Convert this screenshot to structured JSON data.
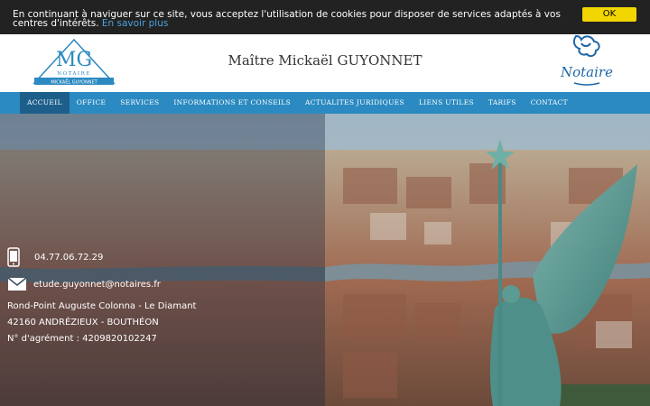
{
  "cookie": {
    "message": "En continuant à naviguer sur ce site, vous acceptez l'utilisation de cookies pour disposer de services adaptés à vos centres d'intérêts.",
    "link": "En savoir plus",
    "ok": "OK"
  },
  "header": {
    "logo_initials": "MG",
    "logo_notaire": "NOTAIRE",
    "logo_name": "MICKAËL GUYONNET",
    "title": "Maître Mickaël GUYONNET",
    "right_logo_text": "Notaire"
  },
  "nav": {
    "items": [
      "ACCUEIL",
      "OFFICE",
      "SERVICES",
      "INFORMATIONS ET CONSEILS",
      "ACTUALITES JURIDIQUES",
      "LIENS UTILES",
      "TARIFS",
      "CONTACT"
    ]
  },
  "contact": {
    "phone": "04.77.06.72.29",
    "email": "etude.guyonnet@notaires.fr",
    "address1": "Rond-Point Auguste Colonna - Le Diamant",
    "address2": "42160 ANDRÉZIEUX - BOUTHÉON",
    "agrement": "N° d'agrément : 4209820102247"
  },
  "colors": {
    "nav": "#2b8ac1",
    "nav_active": "#1d5f8a",
    "cookie_bg": "#222222",
    "cookie_button": "#f1d600"
  }
}
